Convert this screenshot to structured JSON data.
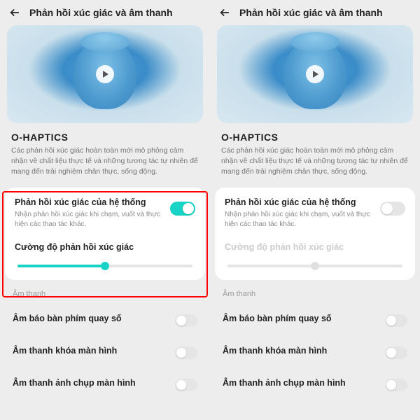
{
  "header": {
    "title": "Phản hồi xúc giác và âm thanh"
  },
  "ohaptics": {
    "title": "O-HAPTICS",
    "desc": "Các phản hồi xúc giác hoàn toàn mới mô phỏng cảm nhận về chất liệu thực tế và những tương tác tự nhiên để mang đến trải nghiệm chân thực, sống động."
  },
  "system_haptics": {
    "title": "Phản hồi xúc giác của hệ thống",
    "desc": "Nhận phản hồi xúc giác khi chạm, vuốt và thực hiện các thao tác khác."
  },
  "intensity": {
    "label": "Cường độ phản hồi xúc giác"
  },
  "sound_section": "Âm thanh",
  "sound_items": {
    "dialpad": "Âm báo bàn phím quay số",
    "lockscreen": "Âm thanh khóa màn hình",
    "screenshot": "Âm thanh ảnh chụp màn hình"
  },
  "left": {
    "enabled": true,
    "slider_pct": 50
  },
  "right": {
    "enabled": false,
    "slider_pct": 50
  }
}
